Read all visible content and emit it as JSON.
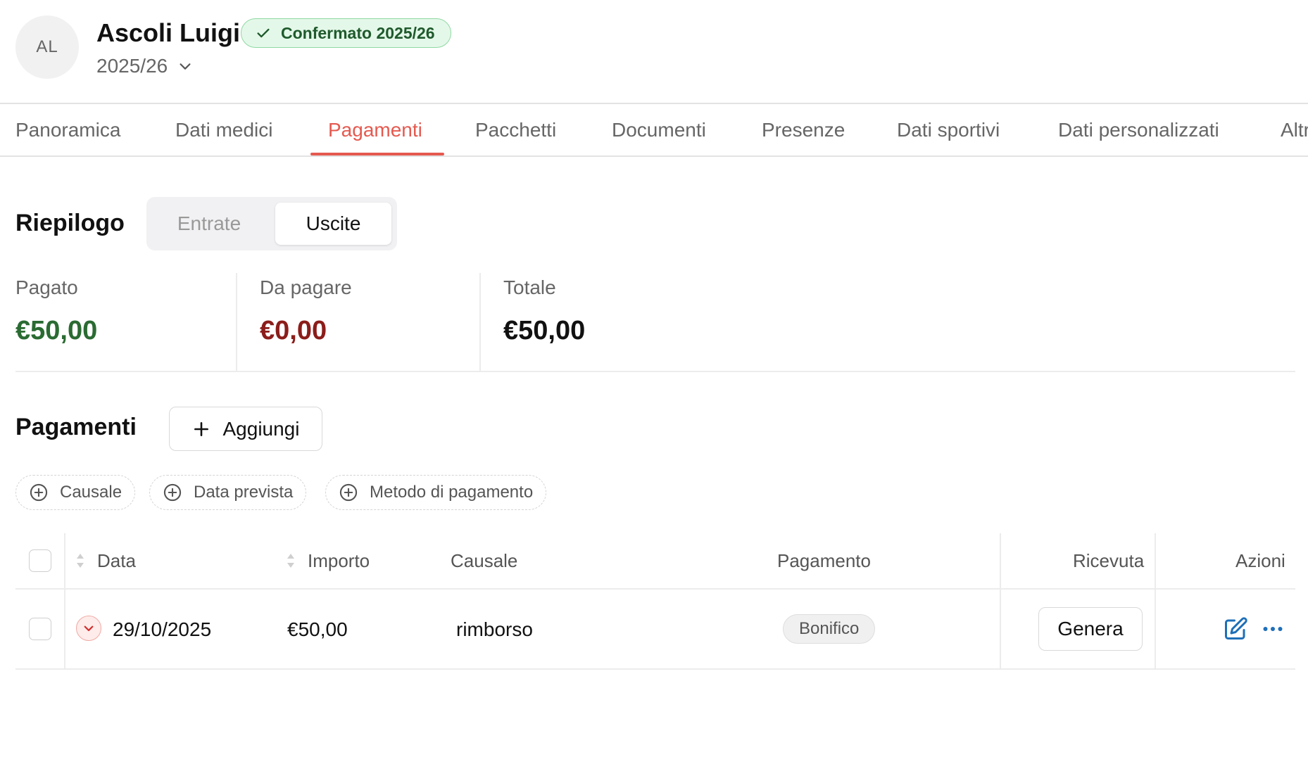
{
  "person": {
    "initials": "AL",
    "name": "Ascoli Luigi",
    "status": "Confermato 2025/26",
    "season": "2025/26"
  },
  "tabs": [
    {
      "label": "Panoramica"
    },
    {
      "label": "Dati medici"
    },
    {
      "label": "Pagamenti"
    },
    {
      "label": "Pacchetti"
    },
    {
      "label": "Documenti"
    },
    {
      "label": "Presenze"
    },
    {
      "label": "Dati sportivi"
    },
    {
      "label": "Dati personalizzati"
    },
    {
      "label": "Altr"
    }
  ],
  "active_tab": "Pagamenti",
  "summary": {
    "title": "Riepilogo",
    "toggle": {
      "entrate": "Entrate",
      "uscite": "Uscite",
      "selected": "Uscite"
    },
    "stats": [
      {
        "label": "Pagato",
        "value": "€50,00",
        "color": "#2a6b32"
      },
      {
        "label": "Da pagare",
        "value": "€0,00",
        "color": "#8b1d1a"
      },
      {
        "label": "Totale",
        "value": "€50,00",
        "color": "#111111"
      }
    ]
  },
  "payments": {
    "title": "Pagamenti",
    "add_label": "Aggiungi",
    "filters": [
      "Causale",
      "Data prevista",
      "Metodo di pagamento"
    ],
    "columns": {
      "data": "Data",
      "importo": "Importo",
      "causale": "Causale",
      "pagamento": "Pagamento",
      "ricevuta": "Ricevuta",
      "azioni": "Azioni"
    },
    "rows": [
      {
        "date": "29/10/2025",
        "amount": "€50,00",
        "causale": "rimborso",
        "method": "Bonifico",
        "receipt_action": "Genera"
      }
    ]
  },
  "colors": {
    "accent": "#e5594f",
    "success_bg": "#e4f8e9",
    "success_border": "#8fd9a3",
    "link_blue": "#1e6fb8"
  },
  "icons": {
    "status": "check-icon",
    "season": "chevron-down-icon",
    "add": "plus-icon",
    "filter": "plus-circle-icon",
    "sort": "sort-icon",
    "expand": "chevron-down-icon",
    "edit": "edit-icon",
    "more": "more-horizontal-icon"
  }
}
